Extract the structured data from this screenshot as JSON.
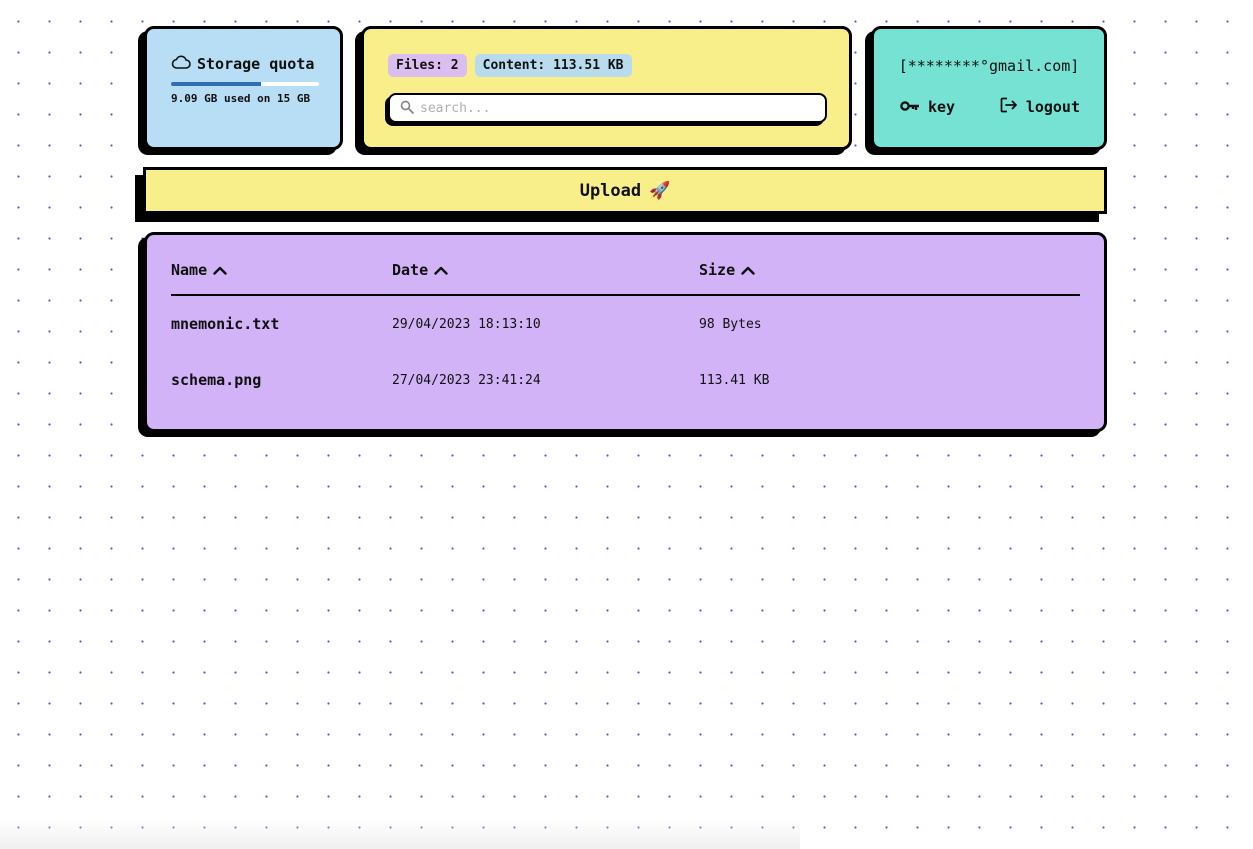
{
  "quota": {
    "icon": "cloud-icon",
    "title": "Storage quota",
    "used_fraction": 0.606,
    "text": "9.09 GB used on 15 GB",
    "bar_color": "#2f6eb6"
  },
  "summary": {
    "files_label": "Files: 2",
    "content_label": "Content: 113.51 KB"
  },
  "search": {
    "icon": "search-icon",
    "placeholder": "search..."
  },
  "user": {
    "email": "[********°gmail.com]",
    "key_icon": "key-icon",
    "key_label": "key",
    "logout_icon": "logout-icon",
    "logout_label": "logout"
  },
  "upload": {
    "label": "Upload",
    "emoji": "🚀"
  },
  "table": {
    "headers": [
      {
        "label": "Name",
        "sort_icon": "chevron-up-icon"
      },
      {
        "label": "Date",
        "sort_icon": "chevron-up-icon"
      },
      {
        "label": "Size",
        "sort_icon": "chevron-up-icon"
      }
    ],
    "rows": [
      {
        "name": "mnemonic.txt",
        "date": "29/04/2023 18:13:10",
        "size": "98 Bytes"
      },
      {
        "name": "schema.png",
        "date": "27/04/2023 23:41:24",
        "size": "113.41 KB"
      }
    ]
  },
  "colors": {
    "quota_card": "#b7def5",
    "search_card": "#f8ee8a",
    "user_card": "#76e2d3",
    "upload_bar": "#f8ee8a",
    "table_card": "#d2b3f7"
  }
}
